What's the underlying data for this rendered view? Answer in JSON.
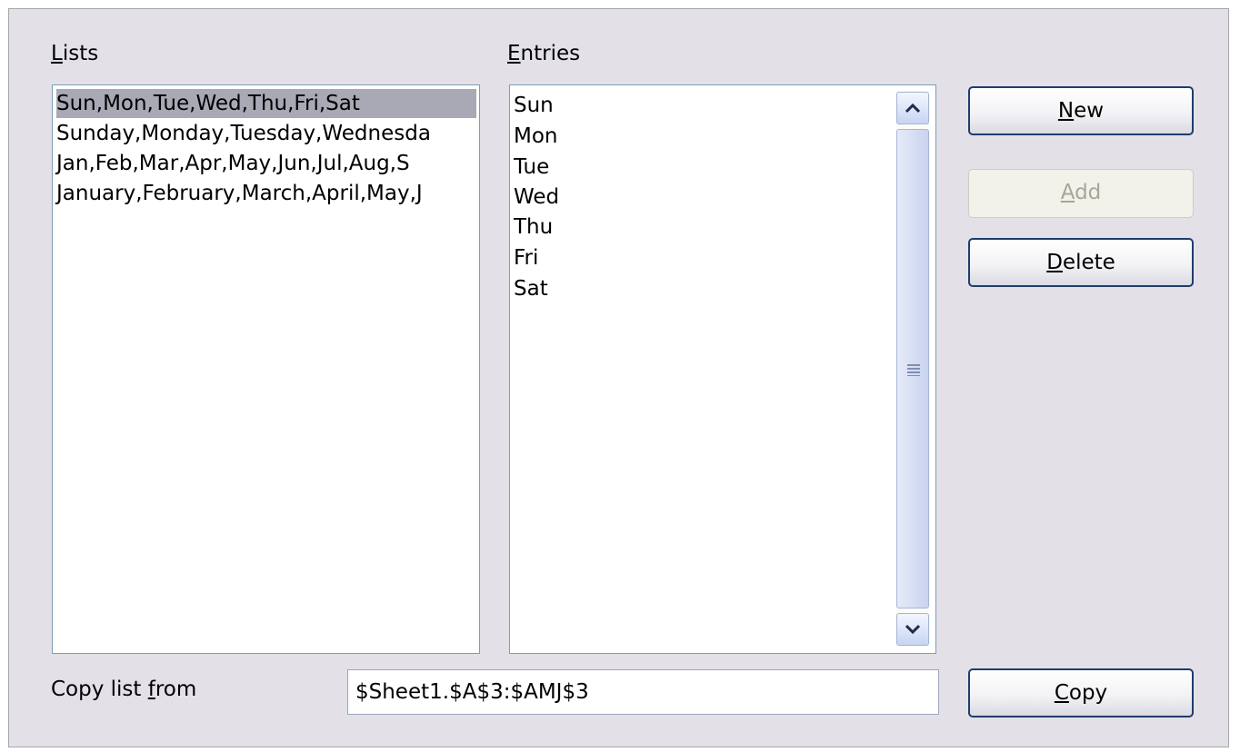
{
  "labels": {
    "lists": {
      "mnemonic": "L",
      "rest": "ists"
    },
    "entries": {
      "mnemonic": "E",
      "rest": "ntries"
    },
    "copy_list_from": {
      "pre": "Copy list ",
      "mnemonic": "f",
      "rest": "rom"
    }
  },
  "lists": {
    "items": [
      "Sun,Mon,Tue,Wed,Thu,Fri,Sat",
      "Sunday,Monday,Tuesday,Wednesda",
      "Jan,Feb,Mar,Apr,May,Jun,Jul,Aug,S",
      "January,February,March,April,May,J"
    ],
    "selected_index": 0
  },
  "entries": {
    "items": [
      "Sun",
      "Mon",
      "Tue",
      "Wed",
      "Thu",
      "Fri",
      "Sat"
    ]
  },
  "buttons": {
    "new": {
      "mnemonic": "N",
      "rest": "ew"
    },
    "add": {
      "mnemonic": "A",
      "rest": "dd",
      "enabled": false
    },
    "delete": {
      "mnemonic": "D",
      "rest": "elete"
    },
    "copy": {
      "mnemonic": "C",
      "rest": "opy"
    }
  },
  "copy_from": {
    "value": "$Sheet1.$A$3:$AMJ$3"
  },
  "icons": {
    "scroll_up": "chevron-up-icon",
    "scroll_down": "chevron-down-icon",
    "scroll_grip": "grip-icon"
  }
}
